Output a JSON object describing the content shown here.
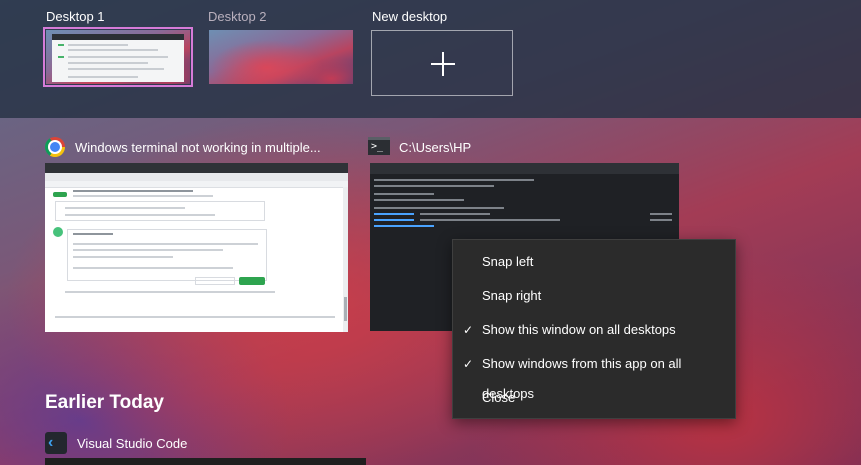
{
  "desktops": {
    "items": [
      {
        "label": "Desktop 1"
      },
      {
        "label": "Desktop 2"
      }
    ],
    "new_label": "New desktop"
  },
  "windows": [
    {
      "title": "Windows terminal not working in multiple...",
      "icon": "chrome-icon"
    },
    {
      "title": "C:\\Users\\HP",
      "icon": "terminal-icon"
    }
  ],
  "context_menu": {
    "items": [
      {
        "label": "Snap left",
        "checked": false
      },
      {
        "label": "Snap right",
        "checked": false
      },
      {
        "label": "Show this window on all desktops",
        "checked": true
      },
      {
        "label": "Show windows from this app on all desktops",
        "checked": true
      },
      {
        "label": "Close",
        "checked": false
      }
    ],
    "check_glyph": "✓"
  },
  "earlier": {
    "heading": "Earlier Today",
    "items": [
      {
        "title": "Visual Studio Code",
        "icon": "vscode-icon"
      }
    ]
  },
  "colors": {
    "active_desktop_outline": "#d67bd8",
    "menu_background": "#2b2b2b"
  }
}
